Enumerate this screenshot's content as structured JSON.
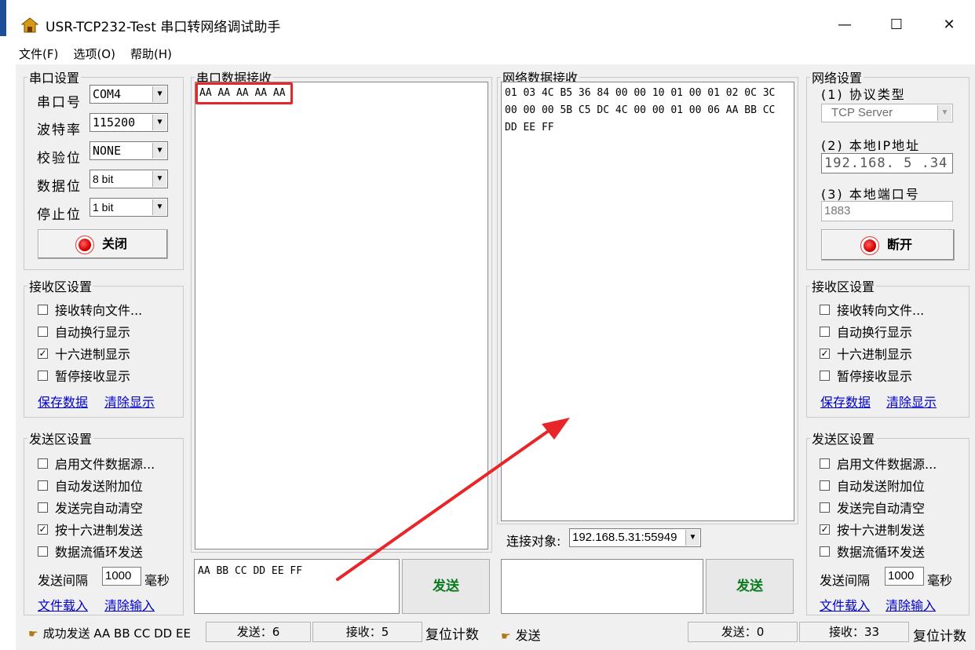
{
  "window": {
    "title": "USR-TCP232-Test 串口转网络调试助手",
    "minimize": "—",
    "maximize": "☐",
    "close": "✕"
  },
  "menu": [
    "文件(F)",
    "选项(O)",
    "帮助(H)"
  ],
  "serial_settings": {
    "legend": "串口设置",
    "port_label": "串口号",
    "port_value": "COM4",
    "baud_label": "波特率",
    "baud_value": "115200",
    "parity_label": "校验位",
    "parity_value": "NONE",
    "databits_label": "数据位",
    "databits_value": "8 bit",
    "stopbits_label": "停止位",
    "stopbits_value": "1 bit",
    "toggle_button": "关闭"
  },
  "left_receive": {
    "legend": "接收区设置",
    "options": [
      {
        "label": "接收转向文件...",
        "checked": false
      },
      {
        "label": "自动换行显示",
        "checked": false
      },
      {
        "label": "十六进制显示",
        "checked": true
      },
      {
        "label": "暂停接收显示",
        "checked": false
      }
    ],
    "save_link": "保存数据",
    "clear_link": "清除显示"
  },
  "left_send": {
    "legend": "发送区设置",
    "options": [
      {
        "label": "启用文件数据源...",
        "checked": false
      },
      {
        "label": "自动发送附加位",
        "checked": false
      },
      {
        "label": "发送完自动清空",
        "checked": false
      },
      {
        "label": "按十六进制发送",
        "checked": true
      },
      {
        "label": "数据流循环发送",
        "checked": false
      }
    ],
    "interval_label": "发送间隔",
    "interval_value": "1000",
    "interval_unit": "毫秒",
    "load_link": "文件载入",
    "clear_link": "清除输入"
  },
  "serial_receive": {
    "legend": "串口数据接收",
    "content": "AA AA AA AA AA"
  },
  "serial_send": {
    "content": "AA BB CC DD EE FF",
    "send_button": "发送"
  },
  "network_receive": {
    "legend": "网络数据接收",
    "content": "01 03 4C B5 36 84 00 00 10 01 00 01 02 0C 3C 00 00 00 5B C5 DC 4C 00 00 01 00 06 AA BB CC DD EE FF"
  },
  "connection": {
    "label": "连接对象:",
    "value": "192.168.5.31:55949"
  },
  "network_send": {
    "content": "",
    "send_button": "发送"
  },
  "network_settings": {
    "legend": "网络设置",
    "protocol_label": "(1) 协议类型",
    "protocol_value": "TCP Server",
    "ip_label": "(2) 本地IP地址",
    "ip_value": "192.168. 5 .34",
    "port_label": "(3) 本地端口号",
    "port_value": "1883",
    "toggle_button": "断开"
  },
  "right_receive": {
    "legend": "接收区设置",
    "options": [
      {
        "label": "接收转向文件...",
        "checked": false
      },
      {
        "label": "自动换行显示",
        "checked": false
      },
      {
        "label": "十六进制显示",
        "checked": true
      },
      {
        "label": "暂停接收显示",
        "checked": false
      }
    ],
    "save_link": "保存数据",
    "clear_link": "清除显示"
  },
  "right_send": {
    "legend": "发送区设置",
    "options": [
      {
        "label": "启用文件数据源...",
        "checked": false
      },
      {
        "label": "自动发送附加位",
        "checked": false
      },
      {
        "label": "发送完自动清空",
        "checked": false
      },
      {
        "label": "按十六进制发送",
        "checked": true
      },
      {
        "label": "数据流循环发送",
        "checked": false
      }
    ],
    "interval_label": "发送间隔",
    "interval_value": "1000",
    "interval_unit": "毫秒",
    "load_link": "文件载入",
    "clear_link": "清除输入"
  },
  "status_left": {
    "message": "成功发送 AA BB CC DD EE",
    "sent": "发送：6",
    "received": "接收：5",
    "reset": "复位计数"
  },
  "status_right": {
    "message": "发送",
    "sent": "发送：0",
    "received": "接收：33",
    "reset": "复位计数"
  },
  "colors": {
    "highlight_box": "#e8262a",
    "arrow": "#e8262a",
    "link": "#0000cc",
    "send_text": "#0a7a20"
  }
}
